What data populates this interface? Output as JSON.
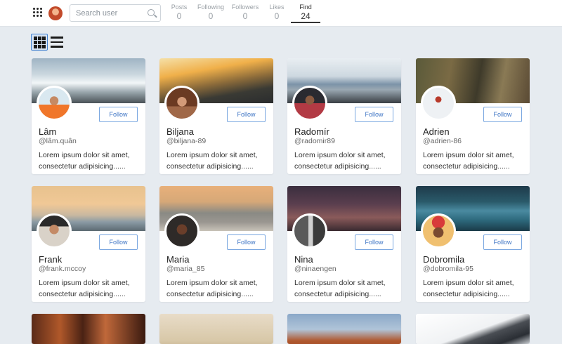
{
  "header": {
    "search_placeholder": "Search user",
    "stats": [
      {
        "label": "Posts",
        "value": "0"
      },
      {
        "label": "Following",
        "value": "0"
      },
      {
        "label": "Followers",
        "value": "0"
      },
      {
        "label": "Likes",
        "value": "0"
      },
      {
        "label": "Find",
        "value": "24"
      }
    ]
  },
  "view": {
    "selected": "grid"
  },
  "follow_label": "Follow",
  "users": [
    {
      "name": "Lâm",
      "handle": "@lâm.quân",
      "desc": "Lorem ipsum dolor sit amet, consectetur adipisicing......"
    },
    {
      "name": "Biljana",
      "handle": "@biljana-89",
      "desc": "Lorem ipsum dolor sit amet, consectetur adipisicing......"
    },
    {
      "name": "Radomír",
      "handle": "@radomir89",
      "desc": "Lorem ipsum dolor sit amet, consectetur adipisicing......"
    },
    {
      "name": "Adrien",
      "handle": "@adrien-86",
      "desc": "Lorem ipsum dolor sit amet, consectetur adipisicing......"
    },
    {
      "name": "Frank",
      "handle": "@frank.mccoy",
      "desc": "Lorem ipsum dolor sit amet, consectetur adipisicing......"
    },
    {
      "name": "Maria",
      "handle": "@maria_85",
      "desc": "Lorem ipsum dolor sit amet, consectetur adipisicing......"
    },
    {
      "name": "Nina",
      "handle": "@ninaengen",
      "desc": "Lorem ipsum dolor sit amet, consectetur adipisicing......"
    },
    {
      "name": "Dobromila",
      "handle": "@dobromila-95",
      "desc": "Lorem ipsum dolor sit amet, consectetur adipisicing......"
    }
  ]
}
